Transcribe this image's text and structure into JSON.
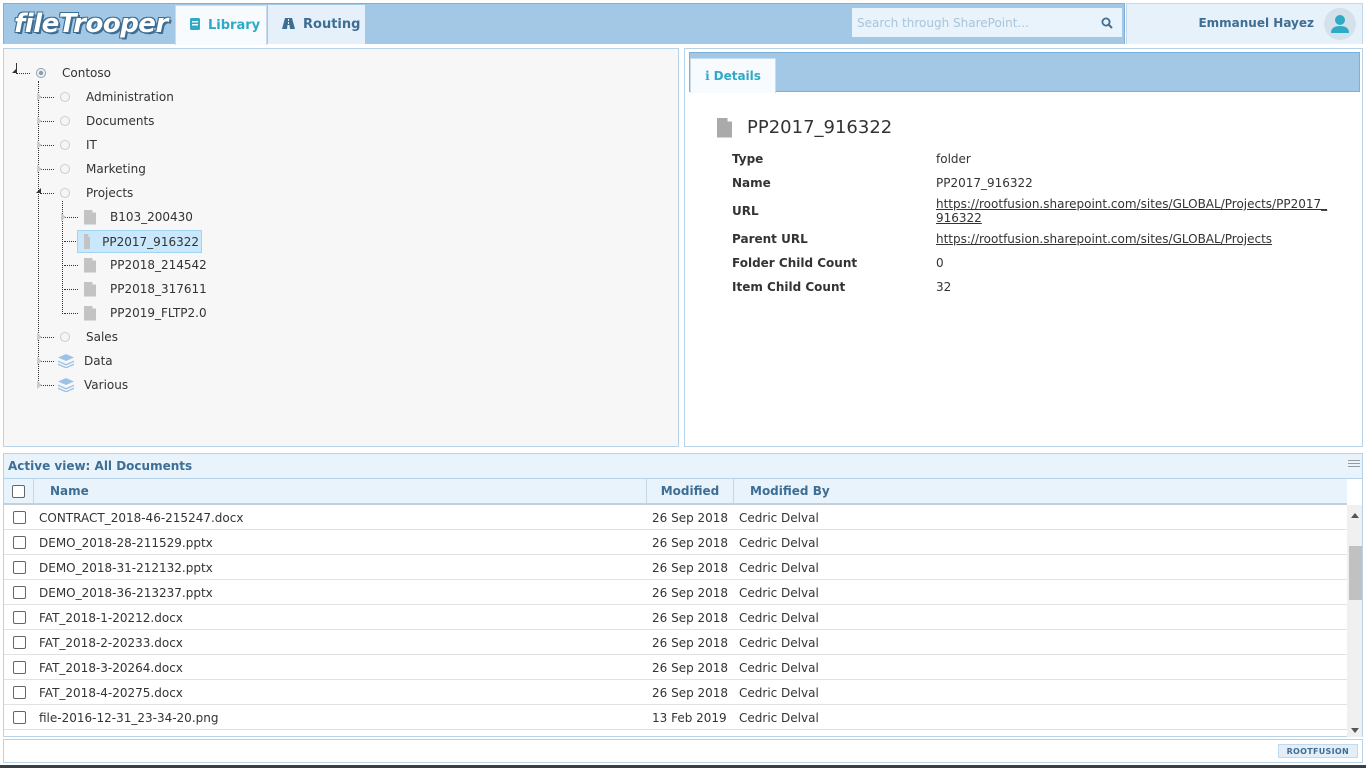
{
  "app": {
    "logo": "fileTrooper",
    "nav_tabs": [
      {
        "label": "Library",
        "icon": "book-icon",
        "active": true
      },
      {
        "label": "Routing",
        "icon": "road-icon",
        "active": false
      }
    ],
    "search": {
      "placeholder": "Search through SharePoint...",
      "value": ""
    },
    "user": {
      "name": "Emmanuel Hayez"
    }
  },
  "tree": {
    "root": {
      "label": "Contoso",
      "expanded": true
    },
    "nodes": [
      {
        "label": "Administration",
        "type": "site",
        "expanded": false
      },
      {
        "label": "Documents",
        "type": "site",
        "expanded": false
      },
      {
        "label": "IT",
        "type": "site",
        "expanded": false
      },
      {
        "label": "Marketing",
        "type": "site",
        "expanded": false
      },
      {
        "label": "Projects",
        "type": "site",
        "expanded": true,
        "children": [
          {
            "label": "B103_200430",
            "type": "folder"
          },
          {
            "label": "PP2017_916322",
            "type": "folder",
            "selected": true
          },
          {
            "label": "PP2018_214542",
            "type": "folder"
          },
          {
            "label": "PP2018_317611",
            "type": "folder"
          },
          {
            "label": "PP2019_FLTP2.0",
            "type": "folder"
          }
        ]
      },
      {
        "label": "Sales",
        "type": "site",
        "expanded": false
      },
      {
        "label": "Data",
        "type": "library",
        "expanded": false
      },
      {
        "label": "Various",
        "type": "library",
        "expanded": false
      }
    ]
  },
  "details": {
    "tab_label": "Details",
    "title": "PP2017_916322",
    "properties": [
      {
        "key": "Type",
        "value": "folder"
      },
      {
        "key": "Name",
        "value": "PP2017_916322"
      },
      {
        "key": "URL",
        "value": "https://rootfusion.sharepoint.com/sites/GLOBAL/Projects/PP2017_916322",
        "link": true
      },
      {
        "key": "Parent URL",
        "value": "https://rootfusion.sharepoint.com/sites/GLOBAL/Projects",
        "link": true
      },
      {
        "key": "Folder Child Count",
        "value": "0"
      },
      {
        "key": "Item Child Count",
        "value": "32"
      }
    ]
  },
  "grid": {
    "title": "Active view: All Documents",
    "columns": [
      "Name",
      "Modified",
      "Modified By"
    ],
    "rows": [
      {
        "name": "CONTRACT_2018-46-215247.docx",
        "modified": "26 Sep 2018",
        "modified_by": "Cedric Delval"
      },
      {
        "name": "DEMO_2018-28-211529.pptx",
        "modified": "26 Sep 2018",
        "modified_by": "Cedric Delval"
      },
      {
        "name": "DEMO_2018-31-212132.pptx",
        "modified": "26 Sep 2018",
        "modified_by": "Cedric Delval"
      },
      {
        "name": "DEMO_2018-36-213237.pptx",
        "modified": "26 Sep 2018",
        "modified_by": "Cedric Delval"
      },
      {
        "name": "FAT_2018-1-20212.docx",
        "modified": "26 Sep 2018",
        "modified_by": "Cedric Delval"
      },
      {
        "name": "FAT_2018-2-20233.docx",
        "modified": "26 Sep 2018",
        "modified_by": "Cedric Delval"
      },
      {
        "name": "FAT_2018-3-20264.docx",
        "modified": "26 Sep 2018",
        "modified_by": "Cedric Delval"
      },
      {
        "name": "FAT_2018-4-20275.docx",
        "modified": "26 Sep 2018",
        "modified_by": "Cedric Delval"
      },
      {
        "name": "file-2016-12-31_23-34-20.png",
        "modified": "13 Feb 2019",
        "modified_by": "Cedric Delval"
      }
    ]
  },
  "footer": {
    "brand": "ROOTFUSION"
  }
}
